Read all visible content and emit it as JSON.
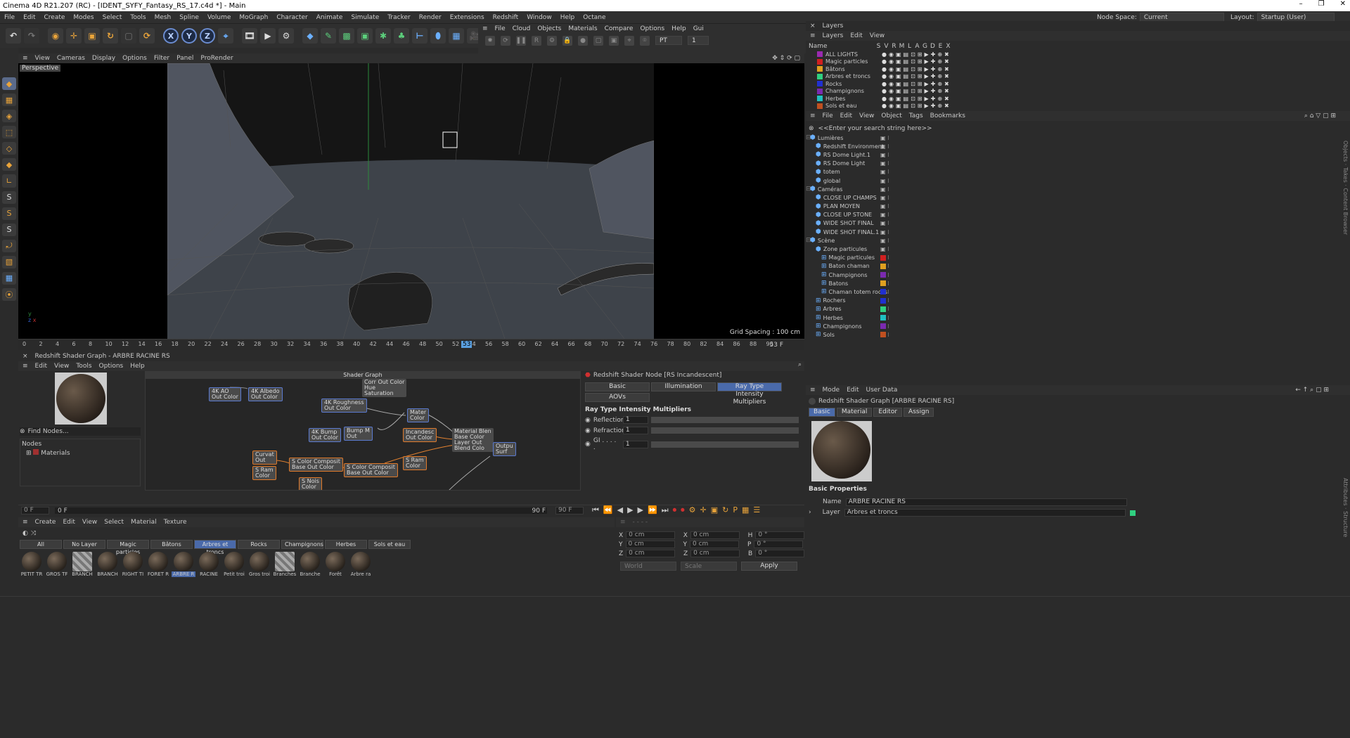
{
  "window": {
    "title": "Cinema 4D R21.207 (RC) - [IDENT_SYFY_Fantasy_RS_17.c4d *] - Main",
    "controls": [
      "–",
      "❐",
      "✕"
    ]
  },
  "menu": [
    "File",
    "Edit",
    "Create",
    "Modes",
    "Select",
    "Tools",
    "Mesh",
    "Spline",
    "Volume",
    "MoGraph",
    "Character",
    "Animate",
    "Simulate",
    "Tracker",
    "Render",
    "Extensions",
    "Redshift",
    "Window",
    "Help",
    "Octane"
  ],
  "node_space": {
    "label": "Node Space:",
    "value": "Current (Standard/Physical)"
  },
  "layout": {
    "label": "Layout:",
    "value": "Startup (User)"
  },
  "redshift_toolbar": {
    "menu": [
      "File",
      "Cloud",
      "Objects",
      "Materials",
      "Compare",
      "Options",
      "Help",
      "Gui"
    ],
    "pt": "PT",
    "frame": "1"
  },
  "viewport": {
    "menu": [
      "View",
      "Cameras",
      "Display",
      "Options",
      "Filter",
      "Panel",
      "ProRender"
    ],
    "label": "Perspective",
    "grid_spacing": "Grid Spacing : 100 cm"
  },
  "timeline": {
    "ticks": [
      "0",
      "2",
      "4",
      "6",
      "8",
      "10",
      "12",
      "14",
      "16",
      "18",
      "20",
      "22",
      "24",
      "26",
      "28",
      "30",
      "32",
      "34",
      "36",
      "38",
      "40",
      "42",
      "44",
      "46",
      "48",
      "50",
      "52",
      "54",
      "56",
      "58",
      "60",
      "62",
      "64",
      "66",
      "68",
      "70",
      "72",
      "74",
      "76",
      "78",
      "80",
      "82",
      "84",
      "86",
      "88",
      "90"
    ],
    "current": "53",
    "end": "53 F"
  },
  "frames": {
    "start": "0 F",
    "current": "0 F",
    "end": "90 F",
    "end2": "90 F"
  },
  "layers": {
    "title": "Layers",
    "menu": [
      "Layers",
      "Edit",
      "View"
    ],
    "columns": [
      "Name",
      "S",
      "V",
      "R",
      "M",
      "L",
      "A",
      "G",
      "D",
      "E",
      "X"
    ],
    "items": [
      {
        "name": "ALL LIGHTS",
        "color": "#9a2ab0"
      },
      {
        "name": "Magic particles",
        "color": "#d02020"
      },
      {
        "name": "Bâtons",
        "color": "#e0a020"
      },
      {
        "name": "Arbres et troncs",
        "color": "#30d080"
      },
      {
        "name": "Rocks",
        "color": "#2030d0"
      },
      {
        "name": "Champignons",
        "color": "#7a2ab0"
      },
      {
        "name": "Herbes",
        "color": "#20c0c0"
      },
      {
        "name": "Sols et eau",
        "color": "#c05020"
      }
    ]
  },
  "objects": {
    "menu": [
      "File",
      "Edit",
      "View",
      "Object",
      "Tags",
      "Bookmarks"
    ],
    "search": "<<Enter your search string here>>",
    "items": [
      {
        "name": "Lumières",
        "indent": 0,
        "color": ""
      },
      {
        "name": "Redshift Environment",
        "indent": 1,
        "color": ""
      },
      {
        "name": "RS Dome Light.1",
        "indent": 1,
        "color": ""
      },
      {
        "name": "RS Dome Light",
        "indent": 1,
        "color": ""
      },
      {
        "name": "totem",
        "indent": 1,
        "color": ""
      },
      {
        "name": "global",
        "indent": 1,
        "color": ""
      },
      {
        "name": "Caméras",
        "indent": 0,
        "color": ""
      },
      {
        "name": "CLOSE UP CHAMPS",
        "indent": 1,
        "color": ""
      },
      {
        "name": "PLAN MOYEN",
        "indent": 1,
        "color": ""
      },
      {
        "name": "CLOSE UP STONE",
        "indent": 1,
        "color": ""
      },
      {
        "name": "WIDE SHOT FINAL",
        "indent": 1,
        "color": ""
      },
      {
        "name": "WIDE SHOT FINAL.1",
        "indent": 1,
        "color": ""
      },
      {
        "name": "Scène",
        "indent": 0,
        "color": ""
      },
      {
        "name": "Zone particules",
        "indent": 1,
        "color": ""
      },
      {
        "name": "Magic particules",
        "indent": 2,
        "color": "#d02020"
      },
      {
        "name": "Baton chaman",
        "indent": 2,
        "color": "#e0a020"
      },
      {
        "name": "Champignons",
        "indent": 2,
        "color": "#7a2ab0"
      },
      {
        "name": "Batons",
        "indent": 2,
        "color": "#e0a020"
      },
      {
        "name": "Chaman totem rocks",
        "indent": 2,
        "color": "#2030d0"
      },
      {
        "name": "Rochers",
        "indent": 1,
        "color": "#2030d0"
      },
      {
        "name": "Arbres",
        "indent": 1,
        "color": "#30d080"
      },
      {
        "name": "Herbes",
        "indent": 1,
        "color": "#20c0c0"
      },
      {
        "name": "Champignons",
        "indent": 1,
        "color": "#7a2ab0"
      },
      {
        "name": "Sols",
        "indent": 1,
        "color": "#c05020"
      }
    ]
  },
  "attributes": {
    "menu": [
      "Mode",
      "Edit",
      "User Data"
    ],
    "title": "Redshift Shader Graph [ARBRE RACINE RS]",
    "tabs": [
      "Basic",
      "Material",
      "Editor",
      "Assign"
    ],
    "section": "Basic Properties",
    "name_label": "Name",
    "name_value": "ARBRE RACINE RS",
    "layer_label": "Layer",
    "layer_value": "Arbres et troncs"
  },
  "shader_graph": {
    "title": "Redshift Shader Graph - ARBRE RACINE RS",
    "menu": [
      "Edit",
      "View",
      "Tools",
      "Options",
      "Help"
    ],
    "find": "Find Nodes...",
    "nodes_label": "Nodes",
    "materials_label": "Materials",
    "graph_title": "Shader Graph",
    "node_title": "Redshift Shader Node [RS Incandescent]",
    "tabs": [
      "Basic",
      "Illumination",
      "Ray Type Intensity Multipliers"
    ],
    "aovs": "AOVs",
    "section": "Ray Type Intensity Multipliers",
    "params": [
      {
        "label": "Reflection",
        "value": "1"
      },
      {
        "label": "Refraction",
        "value": "1"
      },
      {
        "label": "GI . . . . .",
        "value": "1"
      }
    ],
    "nodes": [
      {
        "text": "4K AO",
        "sub": "Out Color"
      },
      {
        "text": "4K Albedo",
        "sub": "Out Color"
      },
      {
        "text": "Corr",
        "sub": "Out Color"
      },
      {
        "text": "Hue",
        "sub": "Saturation"
      },
      {
        "text": "4K Roughness",
        "sub": "Out Color"
      },
      {
        "text": "Mater",
        "sub": "Color"
      },
      {
        "text": "4K Bump",
        "sub": "Out Color"
      },
      {
        "text": "Bump M",
        "sub": "Out"
      },
      {
        "text": "Incandesc",
        "sub": "Out Color"
      },
      {
        "text": "Material Blen",
        "sub": "Base Color"
      },
      {
        "text": "Layer Out",
        "sub": "Blend Colo"
      },
      {
        "text": "Outpu",
        "sub": "Surf"
      },
      {
        "text": "Curvat",
        "sub": "Out"
      },
      {
        "text": "S Color Composit",
        "sub": "Base Out Color"
      },
      {
        "text": "S Ram",
        "sub": "Color"
      },
      {
        "text": "S Color Composit",
        "sub": "Base Out Color"
      },
      {
        "text": "S Ram",
        "sub": "Color"
      },
      {
        "text": "S Nois",
        "sub": "Color"
      }
    ]
  },
  "material_manager": {
    "menu": [
      "Create",
      "Edit",
      "View",
      "Select",
      "Material",
      "Texture"
    ],
    "filters": [
      "All",
      "No Layer",
      "Magic particles",
      "Bâtons",
      "Arbres et troncs",
      "Rocks",
      "Champignons",
      "Herbes",
      "Sols et eau"
    ],
    "materials": [
      "PETIT TR",
      "GROS TF",
      "BRANCH",
      "BRANCH",
      "RIGHT TI",
      "FORET R",
      "ARBRE R",
      "RACINE",
      "Petit troi",
      "Gros troi",
      "Branches",
      "Branche",
      "Forêt",
      "Arbre ra"
    ]
  },
  "coordinates": {
    "rows": [
      {
        "a": "X",
        "av": "0 cm",
        "b": "X",
        "bv": "0 cm",
        "c": "H",
        "cv": "0 °"
      },
      {
        "a": "Y",
        "av": "0 cm",
        "b": "Y",
        "bv": "0 cm",
        "c": "P",
        "cv": "0 °"
      },
      {
        "a": "Z",
        "av": "0 cm",
        "b": "Z",
        "bv": "0 cm",
        "c": "B",
        "cv": "0 °"
      }
    ],
    "world": "World",
    "scale": "Scale",
    "apply": "Apply"
  }
}
